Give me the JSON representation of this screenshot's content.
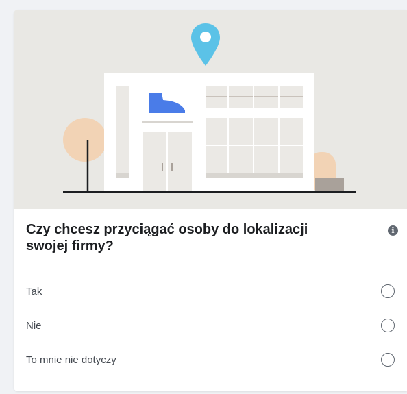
{
  "question": {
    "text": "Czy chcesz przyciągać osoby do lokalizacji swojej firmy?",
    "info_icon": "info-icon"
  },
  "options": [
    {
      "label": "Tak",
      "selected": false
    },
    {
      "label": "Nie",
      "selected": false
    },
    {
      "label": "To mnie nie dotyczy",
      "selected": false
    }
  ],
  "colors": {
    "illustration_background": "#e9e8e4",
    "pin": "#5bc2e7",
    "shoe": "#4a7ce8",
    "bush": "#f2d3b5"
  }
}
